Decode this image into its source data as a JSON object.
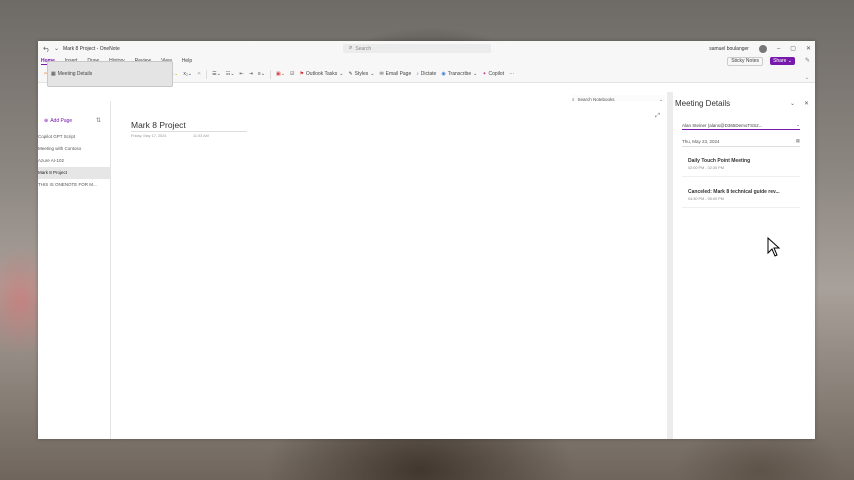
{
  "window": {
    "title": "Mark 8 Project - OneNote",
    "search_placeholder": "Search",
    "user_name": "samuel boulanger"
  },
  "menu": {
    "tabs": [
      "Home",
      "Insert",
      "Draw",
      "History",
      "Review",
      "View",
      "Help"
    ],
    "active_tab": "Home",
    "sticky_notes": "Sticky Notes",
    "share": "Share"
  },
  "ribbon": {
    "font_name": "Calibri",
    "font_size": "11",
    "bold": "B",
    "italic": "I",
    "underline": "U",
    "strike": "ab",
    "outlook_tasks": "Outlook Tasks",
    "styles": "Styles",
    "email_page": "Email Page",
    "meeting_details": "Meeting Details",
    "dictate": "Dictate",
    "transcribe": "Transcribe",
    "copilot": "Copilot",
    "more": "···"
  },
  "sidebar": {
    "add_page": "Add Page",
    "search_notebooks": "Search Notebooks",
    "pages": [
      {
        "label": "Copilot GPT Script"
      },
      {
        "label": "Meeting with Contoso"
      },
      {
        "label": "Azure AI-102"
      },
      {
        "label": "Mark 8 Project"
      },
      {
        "label": "THIS IS ONENOTE FOR M..."
      }
    ],
    "selected_page": "Mark 8 Project"
  },
  "page": {
    "title": "Mark 8 Project",
    "date": "Friday, May 17, 2024",
    "time": "11:03 AM"
  },
  "meeting_panel": {
    "title": "Meeting Details",
    "attendee": "Alan Steiner (alans@D365DemoTSS2...",
    "date": "Thu, May 23, 2024",
    "meetings": [
      {
        "title": "Daily Touch Point Meeting",
        "time": "02:00 PM - 02:30 PM"
      },
      {
        "title": "Canceled: Mark 8 technical guide rev...",
        "time": "04:30 PM - 05:00 PM"
      }
    ]
  },
  "colors": {
    "accent": "#7719aa"
  }
}
